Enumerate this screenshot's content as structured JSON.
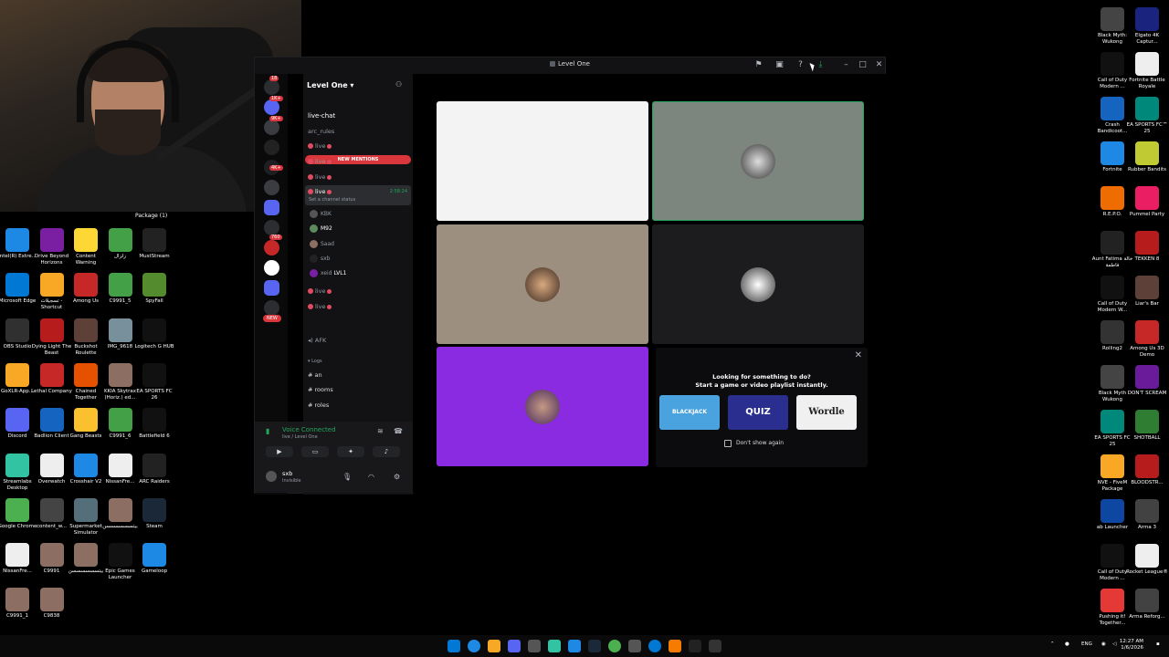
{
  "colors": {
    "discord_red": "#da373c",
    "discord_green": "#23a55a",
    "tile_purple": "#8a2be2"
  },
  "webcam": {
    "overlay_label": "Package (1)"
  },
  "desktop_left": [
    {
      "label": "Intel(R) Extre...",
      "icon": "intel-icon",
      "color": "#1e88e5"
    },
    {
      "label": "Drive Beyond Horizons",
      "icon": "game-icon",
      "color": "#7b1fa2"
    },
    {
      "label": "Content Warning",
      "icon": "game-icon",
      "color": "#fdd835"
    },
    {
      "label": "زلزال",
      "icon": "game-icon",
      "color": "#43a047"
    },
    {
      "label": "MustStream",
      "icon": "app-icon",
      "color": "#222222"
    },
    {
      "label": "Microsoft Edge",
      "icon": "edge-icon",
      "color": "#0078d4"
    },
    {
      "label": "تسجيلات - Shortcut",
      "icon": "folder-icon",
      "color": "#f9a825"
    },
    {
      "label": "Among Us",
      "icon": "game-icon",
      "color": "#c62828"
    },
    {
      "label": "C9991_5",
      "icon": "game-icon",
      "color": "#43a047"
    },
    {
      "label": "SpyFall",
      "icon": "game-icon",
      "color": "#558b2f"
    },
    {
      "label": "OBS Studio",
      "icon": "obs-icon",
      "color": "#303030"
    },
    {
      "label": "Dying Light The Beast",
      "icon": "game-icon",
      "color": "#b71c1c"
    },
    {
      "label": "Buckshot Roulette",
      "icon": "game-icon",
      "color": "#5d4037"
    },
    {
      "label": "IMG_9618",
      "icon": "image-icon",
      "color": "#78909c"
    },
    {
      "label": "Logitech G HUB",
      "icon": "logitech-icon",
      "color": "#111111"
    },
    {
      "label": "GoXLR-App...",
      "icon": "folder-icon",
      "color": "#f9a825"
    },
    {
      "label": "Lethal Company",
      "icon": "game-icon",
      "color": "#c62828"
    },
    {
      "label": "Chained Together",
      "icon": "game-icon",
      "color": "#e65100"
    },
    {
      "label": "KKIA Skytrax (Horiz.) ed...",
      "icon": "image-icon",
      "color": "#8d6e63"
    },
    {
      "label": "EA SPORTS FC 26",
      "icon": "ea-icon",
      "color": "#111111"
    },
    {
      "label": "Discord",
      "icon": "discord-icon",
      "color": "#5865f2"
    },
    {
      "label": "Badlion Client",
      "icon": "game-icon",
      "color": "#1565c0"
    },
    {
      "label": "Gang Beasts",
      "icon": "game-icon",
      "color": "#fbc02d"
    },
    {
      "label": "C9991_6",
      "icon": "game-icon",
      "color": "#43a047"
    },
    {
      "label": "Battlefield 6",
      "icon": "bf-icon",
      "color": "#111111"
    },
    {
      "label": "Streamlabs Desktop",
      "icon": "streamlabs-icon",
      "color": "#31c3a2"
    },
    {
      "label": "Overwatch",
      "icon": "overwatch-icon",
      "color": "#eeeeee"
    },
    {
      "label": "Crosshair V2",
      "icon": "crosshair-icon",
      "color": "#1e88e5"
    },
    {
      "label": "NissanFre...",
      "icon": "file-icon",
      "color": "#eeeeee"
    },
    {
      "label": "ARC Raiders",
      "icon": "game-icon",
      "color": "#222222"
    },
    {
      "label": "Google Chrome",
      "icon": "chrome-icon",
      "color": "#4caf50"
    },
    {
      "label": "content_w...",
      "icon": "file-icon",
      "color": "#444444"
    },
    {
      "label": "Supermarket Simulator",
      "icon": "game-icon",
      "color": "#546e7a"
    },
    {
      "label": "بيتسسسسسسن",
      "icon": "image-icon",
      "color": "#8d6e63"
    },
    {
      "label": "Steam",
      "icon": "steam-icon",
      "color": "#1b2838"
    },
    {
      "label": "NissanFre...",
      "icon": "file-icon",
      "color": "#eeeeee"
    },
    {
      "label": "C9991",
      "icon": "image-icon",
      "color": "#8d6e63"
    },
    {
      "label": "بيتسسسسسسن",
      "icon": "image-icon",
      "color": "#8d6e63"
    },
    {
      "label": "Epic Games Launcher",
      "icon": "epic-icon",
      "color": "#111111"
    },
    {
      "label": "Gameloop",
      "icon": "gameloop-icon",
      "color": "#1e88e5"
    },
    {
      "label": "C9991_1",
      "icon": "image-icon",
      "color": "#8d6e63"
    },
    {
      "label": "C9838",
      "icon": "image-icon",
      "color": "#8d6e63"
    }
  ],
  "desktop_right": [
    {
      "label": "Black Myth: Wukong",
      "icon": "game-icon",
      "color": "#444444"
    },
    {
      "label": "Elgato 4K Captur...",
      "icon": "elgato-icon",
      "color": "#1a237e"
    },
    {
      "label": "Call of Duty Modern ...",
      "icon": "cod-icon",
      "color": "#111111"
    },
    {
      "label": "Fortnite Battle Royale",
      "icon": "file-icon",
      "color": "#eeeeee"
    },
    {
      "label": "Crash Bandicoot...",
      "icon": "game-icon",
      "color": "#1565c0"
    },
    {
      "label": "EA SPORTS FC™ 25",
      "icon": "game-icon",
      "color": "#00897b"
    },
    {
      "label": "Fortnite",
      "icon": "fortnite-icon",
      "color": "#1e88e5"
    },
    {
      "label": "Rubber Bandits",
      "icon": "game-icon",
      "color": "#c0ca33"
    },
    {
      "label": "R.E.P.O.",
      "icon": "game-icon",
      "color": "#ef6c00"
    },
    {
      "label": "Pummel Party",
      "icon": "game-icon",
      "color": "#e91e63"
    },
    {
      "label": "Aunt Fatima خالة فاطمة",
      "icon": "game-icon",
      "color": "#222222"
    },
    {
      "label": "TEKKEN 8",
      "icon": "game-icon",
      "color": "#b71c1c"
    },
    {
      "label": "Call of Duty Modern W...",
      "icon": "cod-icon",
      "color": "#111111"
    },
    {
      "label": "Liar's Bar",
      "icon": "game-icon",
      "color": "#5d4037"
    },
    {
      "label": "Rolling2",
      "icon": "game-icon",
      "color": "#333333"
    },
    {
      "label": "Among Us 3D Demo",
      "icon": "game-icon",
      "color": "#c62828"
    },
    {
      "label": "Black Myth Wukong",
      "icon": "game-icon",
      "color": "#444444"
    },
    {
      "label": "DON'T SCREAM",
      "icon": "game-icon",
      "color": "#6a1b9a"
    },
    {
      "label": "EA SPORTS FC 25",
      "icon": "game-icon",
      "color": "#00897b"
    },
    {
      "label": "SHOTBALL",
      "icon": "game-icon",
      "color": "#2e7d32"
    },
    {
      "label": "NVE - FiveM Package",
      "icon": "folder-icon",
      "color": "#f9a825"
    },
    {
      "label": "BLOODSTR...",
      "icon": "game-icon",
      "color": "#b71c1c"
    },
    {
      "label": "ab Launcher",
      "icon": "game-icon",
      "color": "#0d47a1"
    },
    {
      "label": "Arma 3",
      "icon": "game-icon",
      "color": "#424242"
    },
    {
      "label": "Call of Duty Modern ...",
      "icon": "cod-icon",
      "color": "#111111"
    },
    {
      "label": "Rocket League®",
      "icon": "file-icon",
      "color": "#eeeeee"
    },
    {
      "label": "Pushing it! Together...",
      "icon": "game-icon",
      "color": "#e53935"
    },
    {
      "label": "Arma Reforg...",
      "icon": "game-icon",
      "color": "#424242"
    }
  ],
  "discord": {
    "window_title": "Level One",
    "server_name": "Level One",
    "new_mentions": "NEW MENTIONS",
    "channels_top": [
      {
        "name": "live-chat",
        "kind": "text"
      },
      {
        "name": "arc_rules",
        "kind": "text"
      },
      {
        "name": "live",
        "kind": "live"
      },
      {
        "name": "live",
        "kind": "live"
      },
      {
        "name": "live",
        "kind": "live"
      },
      {
        "name": "live",
        "kind": "live-active",
        "timer": "2:58:24",
        "status": "Set a channel status"
      }
    ],
    "voice_users": [
      "KBK",
      "M92",
      "Saad",
      "sxb",
      "xeid"
    ],
    "voice_user_tag": "LVL1",
    "channels_bottom": [
      {
        "name": "live"
      },
      {
        "name": "live"
      }
    ],
    "afk": "AFK",
    "category_logs": "Logs",
    "text_channels": [
      "an",
      "rooms",
      "roles"
    ],
    "panel": {
      "voice_connected": "Voice Connected",
      "voice_location": "live / Level One",
      "username": "sxb",
      "user_status": "Invisible"
    },
    "server_badges": [
      "18",
      "1K+",
      "9K+",
      "4K+",
      "760",
      "NEW"
    ],
    "promo": {
      "line1": "Looking for something to do?",
      "line2": "Start a game or video playlist instantly.",
      "games": [
        "BLACKJACK",
        "QUIZ",
        "Wordle"
      ],
      "checkbox_label": "Don't show again"
    }
  },
  "taskbar": {
    "lang": "ENG",
    "time": "12:27 AM",
    "date": "1/6/2026"
  }
}
